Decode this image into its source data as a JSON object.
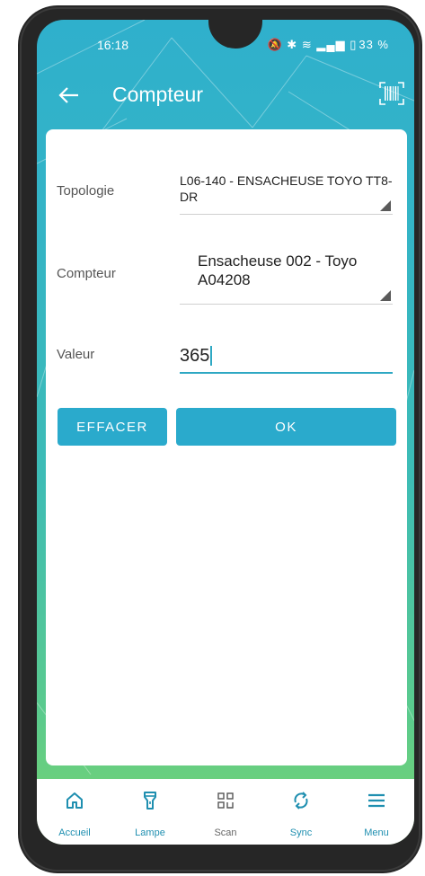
{
  "status_bar": {
    "time": "16:18",
    "battery": "33 %"
  },
  "app_bar": {
    "title": "Compteur",
    "back_icon": "arrow-left-icon",
    "action_icon": "barcode-icon"
  },
  "form": {
    "topologie": {
      "label": "Topologie",
      "value": "L06-140 - ENSACHEUSE TOYO TT8-DR"
    },
    "compteur": {
      "label": "Compteur",
      "value": "Ensacheuse 002 - Toyo A04208"
    },
    "valeur": {
      "label": "Valeur",
      "value": "365"
    },
    "buttons": {
      "clear": "EFFACER",
      "ok": "OK"
    }
  },
  "bottom_nav": {
    "items": [
      {
        "label": "Accueil",
        "icon": "home-icon"
      },
      {
        "label": "Lampe",
        "icon": "flashlight-icon"
      },
      {
        "label": "Scan",
        "icon": "qr-scan-icon"
      },
      {
        "label": "Sync",
        "icon": "sync-icon"
      },
      {
        "label": "Menu",
        "icon": "menu-icon"
      }
    ]
  },
  "colors": {
    "primary": "#2aaacc",
    "gradient_top": "#2fb0cc",
    "gradient_bottom": "#79d46f",
    "nav_label": "#1f8fb0"
  }
}
